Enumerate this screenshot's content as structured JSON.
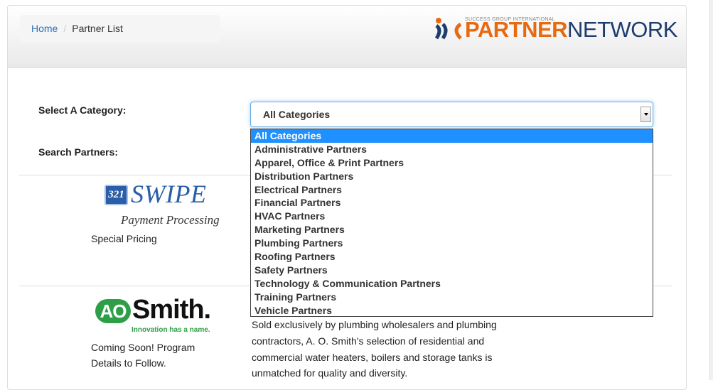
{
  "breadcrumb": {
    "home": "Home",
    "separator": "/",
    "current": "Partner List"
  },
  "logo": {
    "tagline": "SUCCESS GROUP INTERNATIONAL",
    "part1": "PARTNER",
    "part2": "NETWORK",
    "mark": "XC"
  },
  "filters": {
    "category_label": "Select A Category:",
    "search_label": "Search Partners:",
    "selected_category": "All Categories",
    "options": [
      "All Categories",
      "Administrative Partners",
      "Apparel, Office & Print Partners",
      "Distribution Partners",
      "Electrical Partners",
      "Financial Partners",
      "HVAC Partners",
      "Marketing Partners",
      "Plumbing Partners",
      "Roofing Partners",
      "Safety Partners",
      "Technology & Communication Partners",
      "Training Partners",
      "Vehicle Partners"
    ]
  },
  "partners": [
    {
      "logo_badge": "321",
      "logo_word": "SWIPE",
      "logo_sub": "Payment Processing",
      "note": "Special Pricing"
    },
    {
      "logo_ao": "AO",
      "logo_word": "Smith.",
      "logo_tag": "Innovation has a name.",
      "note_line1": "Coming Soon! Program",
      "note_line2": "Details to Follow.",
      "desc_lines": [
        "Sold exclusively by plumbing wholesalers and plumbing",
        "contractors, A. O. Smith's selection of residential and",
        "commercial water heaters, boilers and storage tanks is",
        "unmatched for quality and diversity."
      ]
    }
  ],
  "colors": {
    "accent": "#1e90ff",
    "link": "#2a6ebb",
    "logo_orange": "#e86a10",
    "logo_navy": "#1e3d6e",
    "ao_green": "#2e9e48"
  }
}
